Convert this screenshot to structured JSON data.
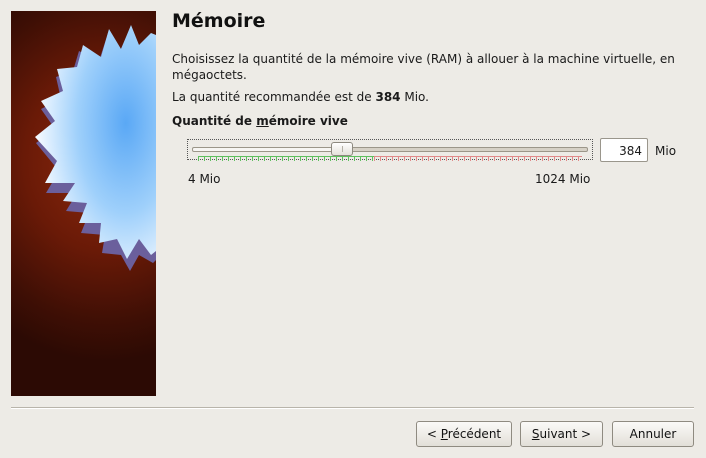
{
  "page": {
    "title": "Mémoire",
    "description": "Choisissez la quantité de la mémoire vive (RAM) à allouer à la machine virtuelle, en mégaoctets.",
    "recommended_prefix": "La quantité recommandée est de ",
    "recommended_value": "384",
    "recommended_unit": " Mio."
  },
  "memory": {
    "label_before": "Quantité de ",
    "label_mnemonic": "m",
    "label_after": "émoire vive",
    "value": "384",
    "unit": "Mio",
    "min_label": "4 Mio",
    "max_label": "1024 Mio",
    "min_value": 4,
    "max_value": 1024,
    "current_value": 384,
    "recommended_max": 512
  },
  "buttons": {
    "back_before": "< ",
    "back_mnemonic": "P",
    "back_after": "récédent",
    "next_mnemonic": "S",
    "next_after": "uivant >",
    "cancel": "Annuler"
  },
  "colors": {
    "ok_range": "#5fbf5f",
    "warn_range": "#e08a8a"
  }
}
